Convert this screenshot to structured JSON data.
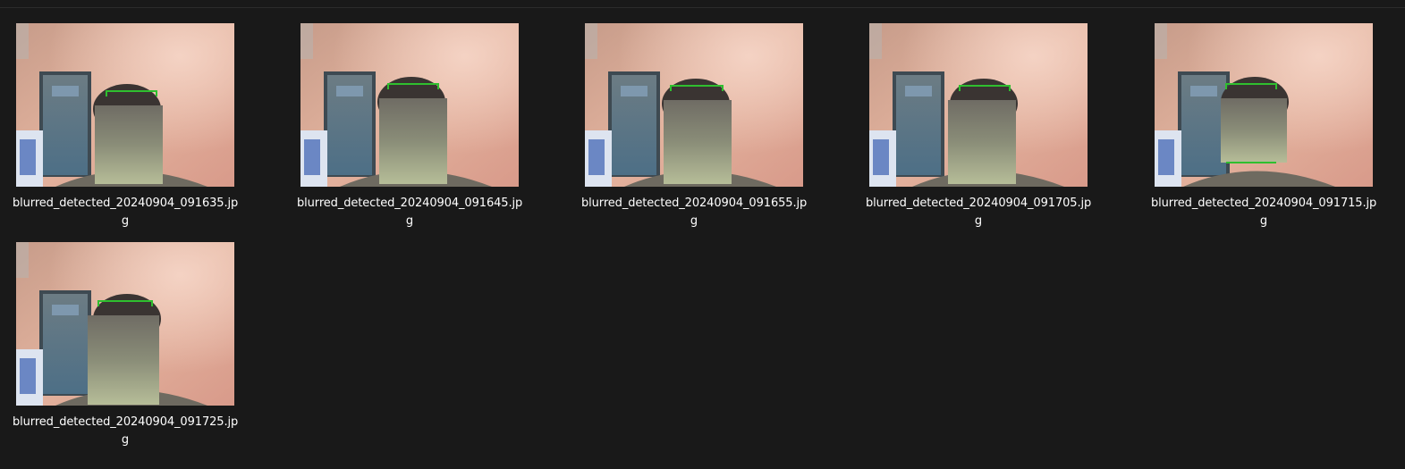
{
  "files": [
    {
      "name_line1": "blurred_detected_20240904_091635.jp",
      "name_line2": "g",
      "thumbnail_icon": "image-thumbnail"
    },
    {
      "name_line1": "blurred_detected_20240904_091645.jp",
      "name_line2": "g",
      "thumbnail_icon": "image-thumbnail"
    },
    {
      "name_line1": "blurred_detected_20240904_091655.jp",
      "name_line2": "g",
      "thumbnail_icon": "image-thumbnail"
    },
    {
      "name_line1": "blurred_detected_20240904_091705.jp",
      "name_line2": "g",
      "thumbnail_icon": "image-thumbnail"
    },
    {
      "name_line1": "blurred_detected_20240904_091715.jp",
      "name_line2": "g",
      "thumbnail_icon": "image-thumbnail"
    },
    {
      "name_line1": "blurred_detected_20240904_091725.jp",
      "name_line2": "g",
      "thumbnail_icon": "image-thumbnail"
    }
  ],
  "colors": {
    "background": "#191919",
    "text": "#ffffff",
    "detection_box": "#2fbf2f"
  }
}
